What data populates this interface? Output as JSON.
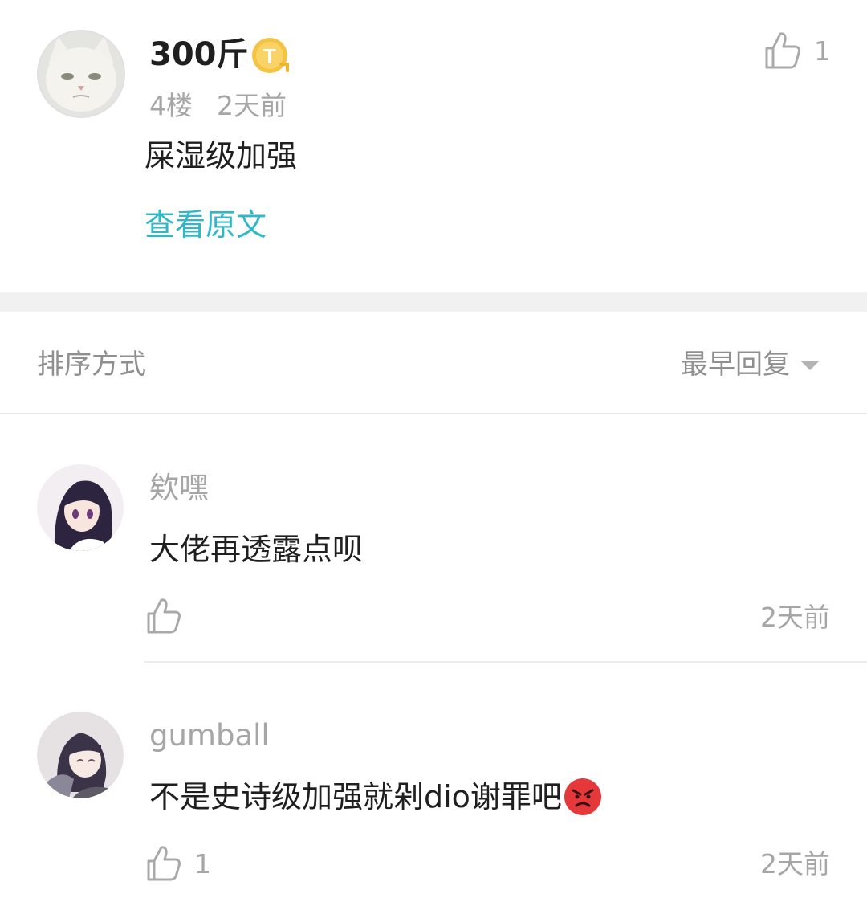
{
  "post": {
    "author": "300斤",
    "floor": "4楼",
    "time": "2天前",
    "like_count": "1",
    "content": "屎湿级加强",
    "view_original": "查看原文",
    "badge_letter": "T"
  },
  "sort": {
    "label": "排序方式",
    "value": "最早回复"
  },
  "replies": [
    {
      "author": "欸嘿",
      "text": "大佬再透露点呗",
      "like_count": "",
      "time": "2天前"
    },
    {
      "author": "gumball",
      "text": "不是史诗级加强就剁dio谢罪吧",
      "emoji": "angry-face-emoji",
      "like_count": "1",
      "time": "2天前"
    }
  ],
  "colors": {
    "link": "#2fb8c8",
    "meta": "#a6a6a6",
    "badge": "#f5c343"
  }
}
